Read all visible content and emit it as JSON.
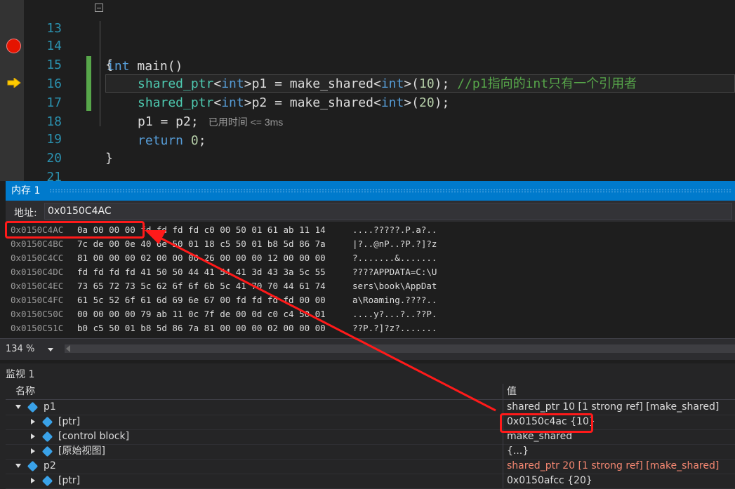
{
  "editor": {
    "lines": [
      {
        "n": "13"
      },
      {
        "n": "14"
      },
      {
        "n": "15"
      },
      {
        "n": "16"
      },
      {
        "n": "17"
      },
      {
        "n": "18"
      },
      {
        "n": "19"
      },
      {
        "n": "20"
      },
      {
        "n": "21"
      }
    ],
    "code": {
      "l13_kw": "int",
      "l13_rest": " main()",
      "l14": "{",
      "l15_a": "shared_ptr",
      "l15_b": "<",
      "l15_c": "int",
      "l15_d": ">p1 = make_shared",
      "l15_e": "<",
      "l15_f": "int",
      "l15_g": ">(",
      "l15_h": "10",
      "l15_i": "); ",
      "l15_cmt": "//p1指向的int只有一个引用者",
      "l16_a": "shared_ptr",
      "l16_b": "<",
      "l16_c": "int",
      "l16_d": ">p2 = make_shared",
      "l16_e": "<",
      "l16_f": "int",
      "l16_g": ">(",
      "l16_h": "20",
      "l16_i": ");",
      "l17": "p1 = p2;",
      "l17_perf": "已用时间 <= 3ms",
      "l18_kw": "return",
      "l18_num": "0",
      "l18_rest": ";",
      "l19": "}"
    }
  },
  "memory": {
    "title": "内存 1",
    "addr_label": "地址:",
    "addr_value": "0x0150C4AC",
    "rows": [
      {
        "addr": "0x0150C4AC",
        "hex": "0a 00 00 00 fd fd fd fd c0 00 50 01 61 ab 11 14",
        "ascii": "....?????.P.a?.."
      },
      {
        "addr": "0x0150C4BC",
        "hex": "7c de 00 0e 40 6e 50 01 18 c5 50 01 b8 5d 86 7a",
        "ascii": "|?..@nP..?P.?]?z"
      },
      {
        "addr": "0x0150C4CC",
        "hex": "81 00 00 00 02 00 00 00 26 00 00 00 12 00 00 00",
        "ascii": "?.......&......."
      },
      {
        "addr": "0x0150C4DC",
        "hex": "fd fd fd fd 41 50 50 44 41 54 41 3d 43 3a 5c 55",
        "ascii": "????APPDATA=C:\\U"
      },
      {
        "addr": "0x0150C4EC",
        "hex": "73 65 72 73 5c 62 6f 6f 6b 5c 41 70 70 44 61 74",
        "ascii": "sers\\book\\AppDat"
      },
      {
        "addr": "0x0150C4FC",
        "hex": "61 5c 52 6f 61 6d 69 6e 67 00 fd fd fd fd 00 00",
        "ascii": "a\\Roaming.????.."
      },
      {
        "addr": "0x0150C50C",
        "hex": "00 00 00 00 79 ab 11 0c 7f de 00 0d c0 c4 50 01",
        "ascii": "....y?...?..??P."
      },
      {
        "addr": "0x0150C51C",
        "hex": "b0 c5 50 01 b8 5d 86 7a 81 00 00 00 02 00 00 00",
        "ascii": "??P.?]?z?......."
      }
    ]
  },
  "zoom": {
    "value": "134 %"
  },
  "watch": {
    "title": "监视 1",
    "col_name": "名称",
    "col_value": "值",
    "rows": [
      {
        "name": "p1",
        "value": "shared_ptr 10 [1 strong ref] [make_shared]"
      },
      {
        "name": "[ptr]",
        "value": "0x0150c4ac {10}"
      },
      {
        "name": "[control block]",
        "value": "make_shared"
      },
      {
        "name": "[原始视图]",
        "value": "{...}"
      },
      {
        "name": "p2",
        "value": "shared_ptr 20 [1 strong ref] [make_shared]"
      },
      {
        "name": "[ptr]",
        "value": "0x0150afcc {20}"
      }
    ]
  },
  "colors": {
    "accent": "#007acc",
    "breakpoint": "#e51400",
    "annotation": "#ff1a1a",
    "changed_value": "#f48771"
  }
}
